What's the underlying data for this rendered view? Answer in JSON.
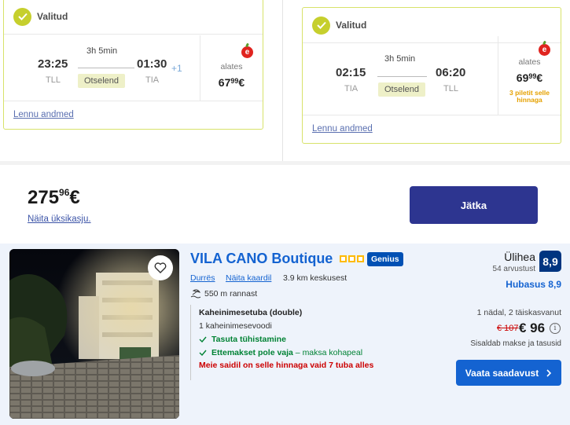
{
  "colors": {
    "accent": "#c6cf2d",
    "primary_button": "#2d3590",
    "booking_blue": "#1463d1",
    "score_bg": "#003580",
    "warn": "#cc0000",
    "perk": "#008234"
  },
  "outbound": {
    "selected_label": "Valitud",
    "duration": "3h 5min",
    "depart_time": "23:25",
    "depart_code": "TLL",
    "arrive_time": "01:30",
    "arrive_code": "TIA",
    "day_offset": "+1",
    "direct_label": "Otselend",
    "from_label": "alates",
    "price_main": "67",
    "price_cents": "99",
    "currency": "€",
    "details_link": "Lennu andmed",
    "airline_icon": "cherry-e-logo"
  },
  "inbound": {
    "selected_label": "Valitud",
    "duration": "3h 5min",
    "depart_time": "02:15",
    "depart_code": "TIA",
    "arrive_time": "06:20",
    "arrive_code": "TLL",
    "direct_label": "Otselend",
    "from_label": "alates",
    "price_main": "69",
    "price_cents": "99",
    "currency": "€",
    "seats_left": "3 piletit selle hinnaga",
    "details_link": "Lennu andmed",
    "airline_icon": "cherry-e-logo"
  },
  "total": {
    "price_main": "275",
    "price_cents": "96",
    "currency": "€",
    "single_price_link": "Näita üksikasju.",
    "continue_label": "Jätka"
  },
  "hotel": {
    "name": "VILA CANO Boutique",
    "stars": 3,
    "genius_label": "Genius",
    "city": "Durrës",
    "map_link": "Näita kaardil",
    "distance": "3.9 km keskusest",
    "beach": "550 m rannast",
    "room_type": "Kaheinimesetuba (double)",
    "beds": "1 kaheinimesevoodi",
    "perk_cancel": "Tasuta tühistamine",
    "perk_prepay_bold": "Ettemakset pole vaja",
    "perk_prepay_rest": " – maksa kohapeal",
    "availability_warning": "Meie saidil on selle hinnaga vaid 7 tuba alles",
    "rating_word": "Ülihea",
    "reviews": "54 arvustust",
    "score": "8,9",
    "subscore": "Hubasus 8,9",
    "stay": "1 nädal, 2 täiskasvanut",
    "old_price": "€ 107",
    "new_price": "€ 96",
    "taxes_note": "Sisaldab makse ja tasusid",
    "availability_button": "Vaata saadavust"
  }
}
